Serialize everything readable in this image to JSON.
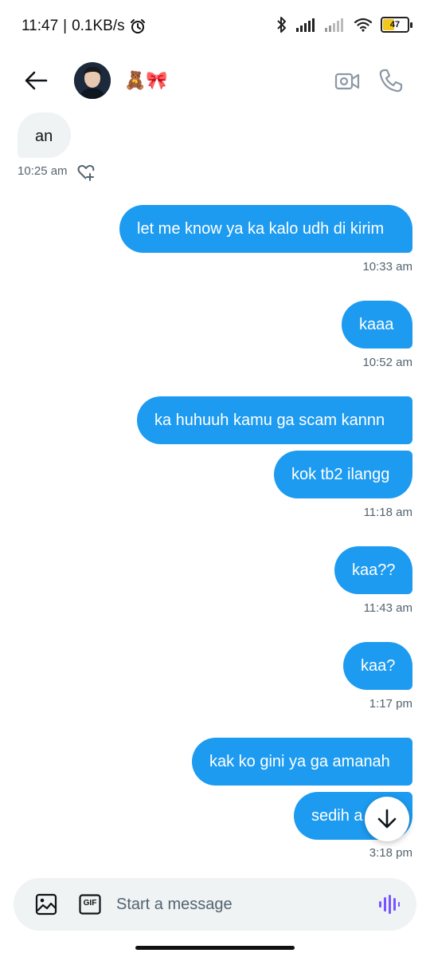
{
  "status": {
    "time": "11:47",
    "speed": "0.1KB/s",
    "battery": "47",
    "icons": [
      "alarm-icon",
      "bluetooth-icon",
      "signal-icon",
      "signal-icon",
      "wifi-icon",
      "battery-icon"
    ]
  },
  "header": {
    "name_emoji": "🧸🎀",
    "icons": [
      "back-arrow-icon",
      "video-call-icon",
      "phone-call-icon"
    ]
  },
  "messages": [
    {
      "dir": "in",
      "text": "an",
      "time": "10:25 am"
    },
    {
      "dir": "out",
      "text": "let me know ya ka kalo udh di kirim",
      "time": "10:33 am"
    },
    {
      "dir": "out",
      "text": "kaaa",
      "time": "10:52 am"
    },
    {
      "dir": "out",
      "text": "ka huhuuh kamu ga scam kannn"
    },
    {
      "dir": "out",
      "text": "kok tb2 ilangg",
      "time": "11:18 am"
    },
    {
      "dir": "out",
      "text": "kaa??",
      "time": "11:43 am"
    },
    {
      "dir": "out",
      "text": "kaa?",
      "time": "1:17 pm"
    },
    {
      "dir": "out",
      "text": "kak ko gini ya ga amanah"
    },
    {
      "dir": "out",
      "text": "sedih a",
      "time": "3:18 pm"
    }
  ],
  "composer": {
    "placeholder": "Start a message",
    "gif_label": "GIF"
  },
  "colors": {
    "outgoing": "#1d9bf0",
    "incoming": "#eff3f4",
    "voice": "#7856ff"
  }
}
